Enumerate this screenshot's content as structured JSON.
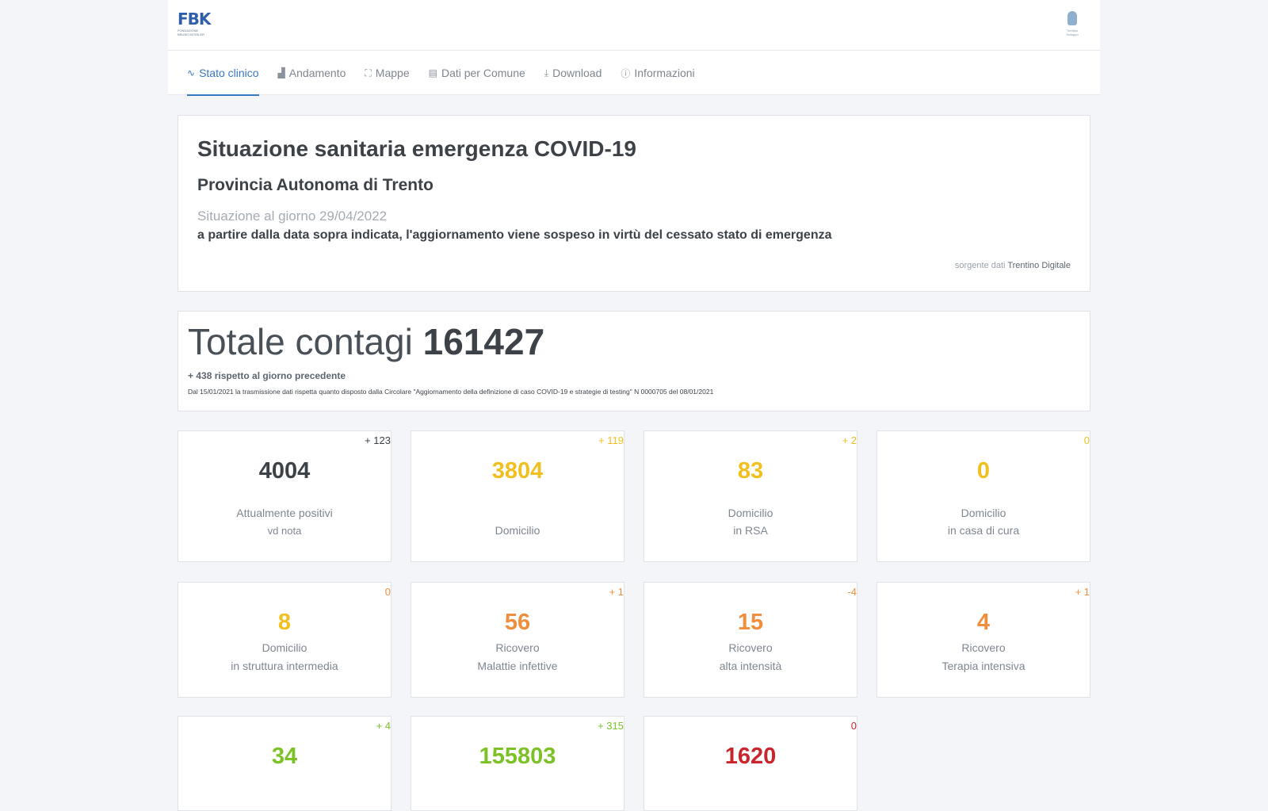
{
  "header": {
    "logo_mark": "FBK",
    "logo_sub": "FONDAZIONE BRUNO KESSLER",
    "right_logo_text": "Trentino Sviluppo"
  },
  "nav": [
    {
      "label": "Stato clinico",
      "icon": "pulse-icon",
      "glyph": "∿",
      "active": true
    },
    {
      "label": "Andamento",
      "icon": "bar-chart-icon",
      "glyph": "▟",
      "active": false
    },
    {
      "label": "Mappe",
      "icon": "map-icon",
      "glyph": "⛶",
      "active": false
    },
    {
      "label": "Dati per Comune",
      "icon": "document-icon",
      "glyph": "▤",
      "active": false
    },
    {
      "label": "Download",
      "icon": "download-icon",
      "glyph": "⤓",
      "active": false
    },
    {
      "label": "Informazioni",
      "icon": "info-icon",
      "glyph": "ⓘ",
      "active": false
    }
  ],
  "intro": {
    "title": "Situazione sanitaria emergenza COVID-19",
    "subtitle": "Provincia Autonoma di Trento",
    "date": "Situazione al giorno 29/04/2022",
    "note": "a partire dalla data sopra indicata, l'aggiornamento viene sospeso in virtù del cessato stato di emergenza",
    "source_prefix": "sorgente dati ",
    "source_name": "Trentino Digitale"
  },
  "totale": {
    "label": "Totale contagi ",
    "value": "161427",
    "delta": "+ 438 rispetto al giorno precedente",
    "footnote": "Dal 15/01/2021 la trasmissione dati rispetta quanto disposto dalla Circolare \"Aggiornamento della definizione di caso COVID-19 e strategie di testing\" N 0000705 del 08/01/2021"
  },
  "colors": {
    "dark": "#3c4248",
    "yellow": "#f0c020",
    "orange": "#ef8e3c",
    "green": "#7cc226",
    "red": "#c8252c",
    "accent": "#3778c2"
  },
  "stats": {
    "attualmente_positivi": {
      "change": "+ 123",
      "value": "4004",
      "line1": "Attualmente positivi",
      "line2": "vd nota"
    },
    "domicilio": {
      "change": "+ 119",
      "value": "3804",
      "line1": "",
      "line2": "Domicilio"
    },
    "domicilio_rsa": {
      "change": "+ 2",
      "value": "83",
      "line1": "Domicilio",
      "line2": "in RSA"
    },
    "domicilio_casa_cura": {
      "change": "0",
      "value": "0",
      "line1": "Domicilio",
      "line2": "in casa di cura"
    },
    "domicilio_struttura": {
      "change": "0",
      "value": "8",
      "line1": "Domicilio",
      "line2": "in struttura intermedia"
    },
    "ricovero_malattie": {
      "change": "+ 1",
      "value": "56",
      "line1": "Ricovero",
      "line2": "Malattie infettive"
    },
    "ricovero_alta": {
      "change": "-4",
      "value": "15",
      "line1": "Ricovero",
      "line2": "alta intensità"
    },
    "ricovero_terapia": {
      "change": "+ 1",
      "value": "4",
      "line1": "Ricovero",
      "line2": "Terapia intensiva"
    },
    "row3_a": {
      "change": "+ 4",
      "value": "34"
    },
    "row3_b": {
      "change": "+ 315",
      "value": "155803"
    },
    "row3_c": {
      "change": "0",
      "value": "1620"
    }
  }
}
